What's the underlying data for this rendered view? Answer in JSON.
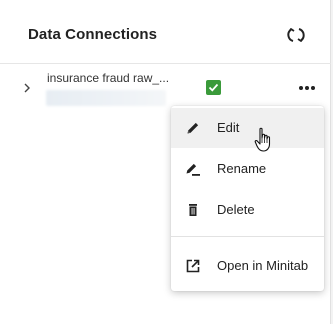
{
  "panel": {
    "title": "Data Connections",
    "refresh_icon": "refresh-icon"
  },
  "connection": {
    "name": "insurance fraud raw_...",
    "status_icon": "check-icon",
    "status_color": "#3a9a3a",
    "more_icon": "more-dots-icon",
    "expand_icon": "chevron-right-icon"
  },
  "context_menu": {
    "items": [
      {
        "label": "Edit",
        "icon": "pencil-icon"
      },
      {
        "label": "Rename",
        "icon": "rename-icon"
      },
      {
        "label": "Delete",
        "icon": "trash-icon"
      },
      {
        "label": "Open in Minitab",
        "icon": "open-external-icon"
      }
    ],
    "hovered": "Edit"
  }
}
